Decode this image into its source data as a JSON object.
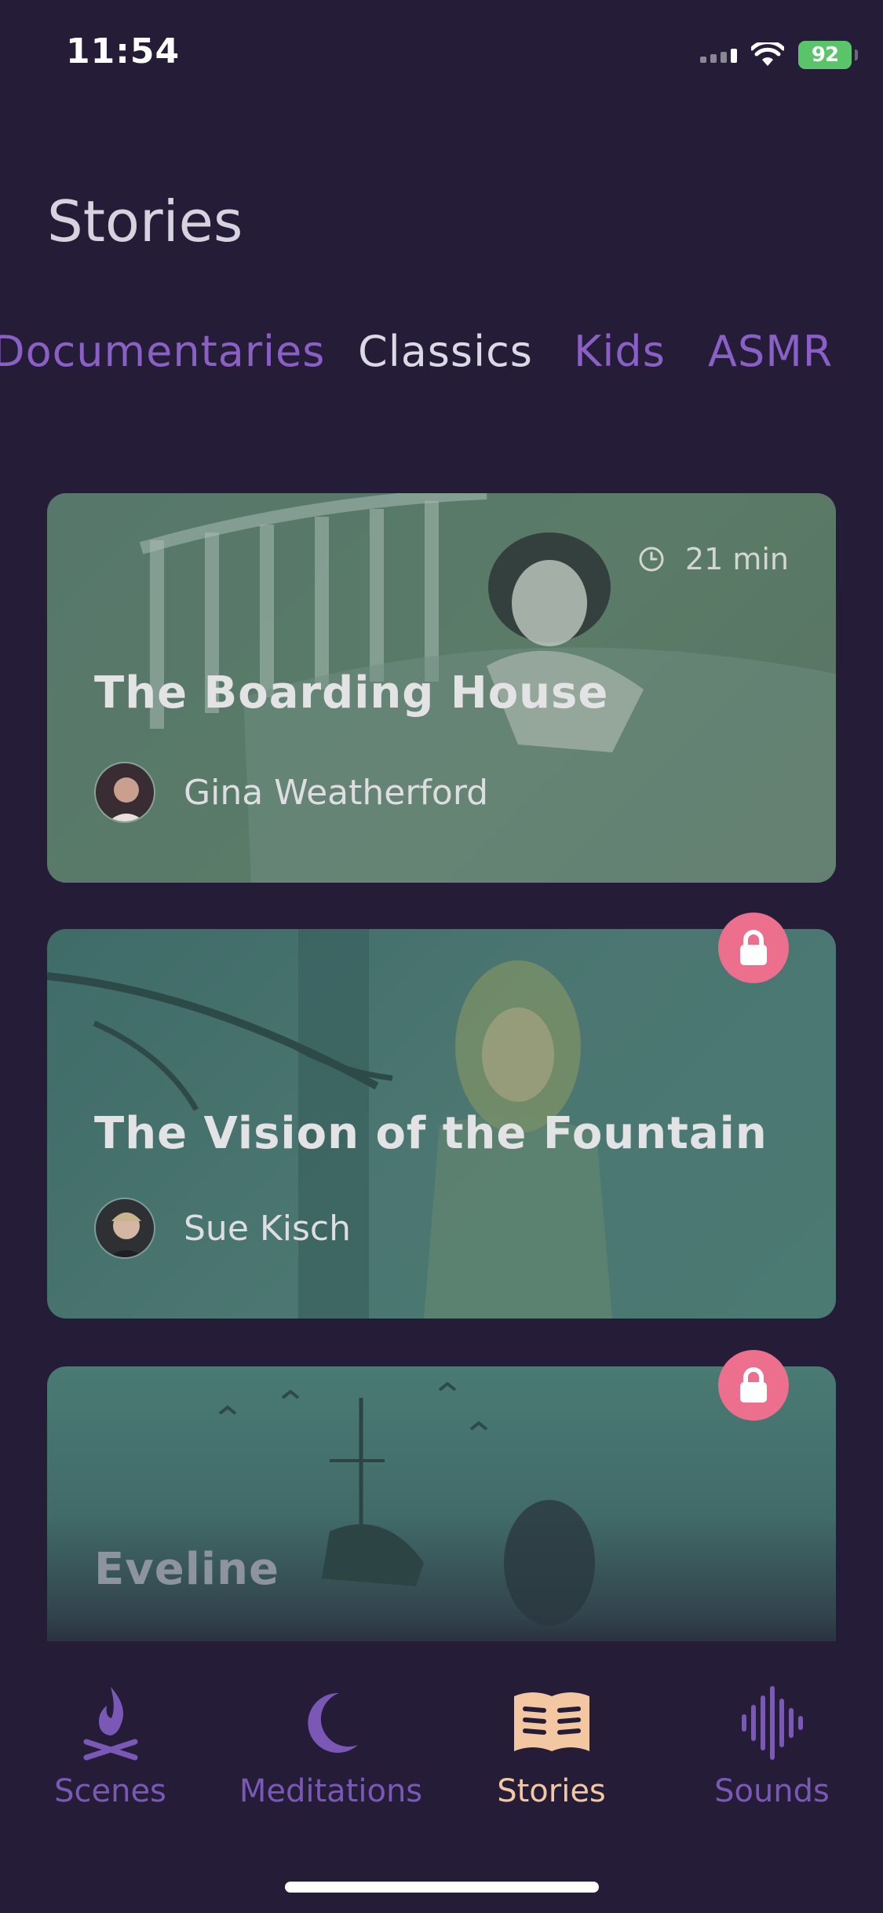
{
  "status_bar": {
    "time": "11:54",
    "battery": "92"
  },
  "page": {
    "title": "Stories"
  },
  "tabs": [
    {
      "label": "Documentaries",
      "active": false
    },
    {
      "label": "Classics",
      "active": true
    },
    {
      "label": "Kids",
      "active": false
    },
    {
      "label": "ASMR",
      "active": false
    }
  ],
  "cards": [
    {
      "title": "The Boarding House",
      "author": "Gina Weatherford",
      "duration": "21 min",
      "locked": false
    },
    {
      "title": "The Vision of the Fountain",
      "author": "Sue Kisch",
      "locked": true
    },
    {
      "title": "Eveline",
      "locked": true
    }
  ],
  "nav": [
    {
      "label": "Scenes",
      "icon": "campfire-icon",
      "active": false
    },
    {
      "label": "Meditations",
      "icon": "moon-icon",
      "active": false
    },
    {
      "label": "Stories",
      "icon": "open-book-icon",
      "active": true
    },
    {
      "label": "Sounds",
      "icon": "sound-wave-icon",
      "active": false
    }
  ],
  "colors": {
    "background": "#251d37",
    "accent_purple": "#7b58b6",
    "active_nav": "#f2c7a1",
    "lock_badge": "#ec6f8e"
  }
}
